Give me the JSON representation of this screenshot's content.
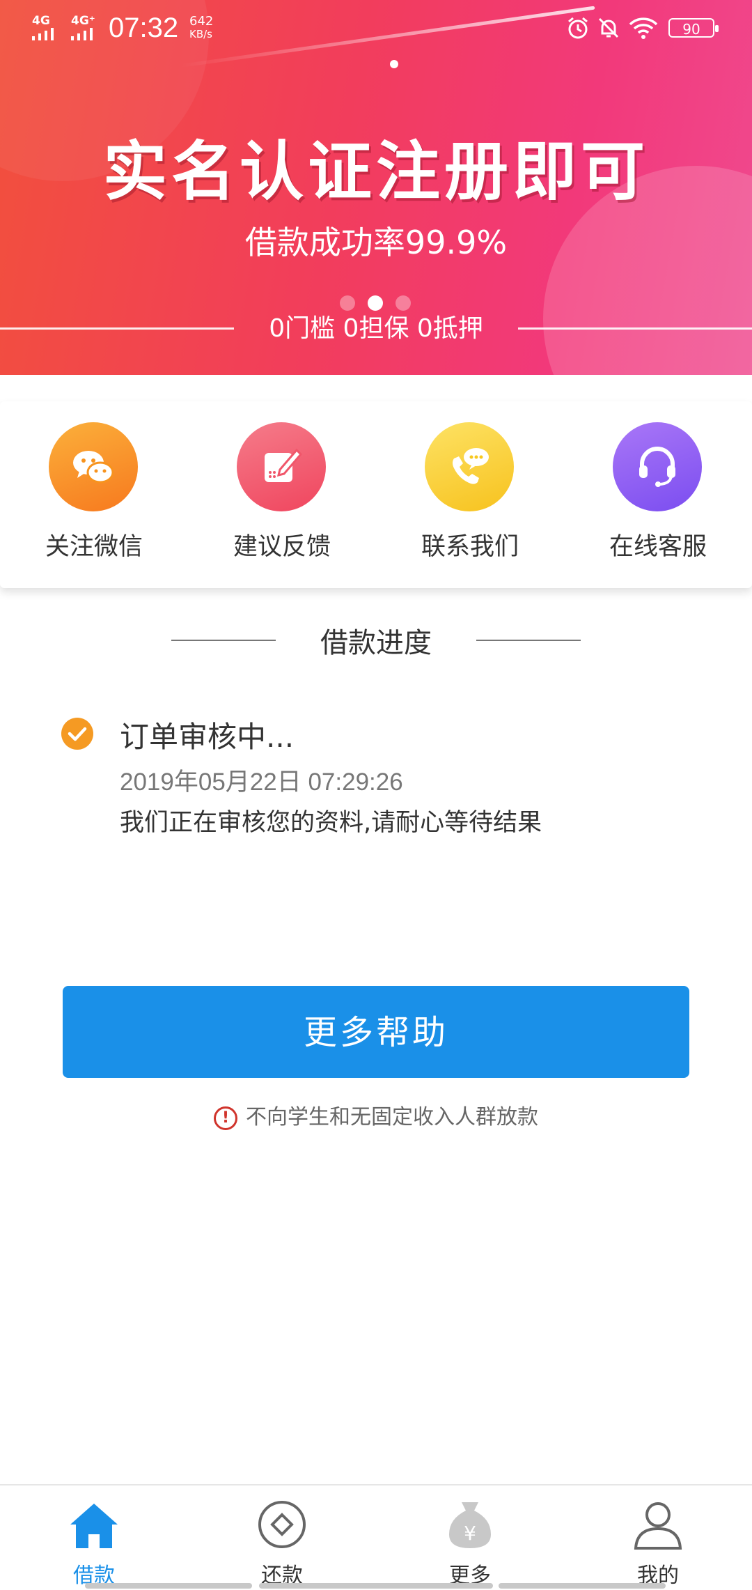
{
  "status_bar": {
    "network1": "4G",
    "network2": "4G⁺",
    "time": "07:32",
    "speed_value": "642",
    "speed_unit": "KB/s",
    "battery": "90",
    "icons": [
      "alarm-icon",
      "bell-muted-icon",
      "wifi-icon",
      "battery-icon"
    ]
  },
  "banner": {
    "headline": "实名认证注册即可",
    "subheadline": "借款成功率99.9%",
    "tags": "0门槛  0担保  0抵押",
    "active_slide": 2,
    "slide_count": 3,
    "colors": {
      "start": "#f2503c",
      "end": "#f04a8f"
    }
  },
  "quick_actions": [
    {
      "label": "关注微信",
      "icon": "wechat-icon",
      "color": "#f7931e"
    },
    {
      "label": "建议反馈",
      "icon": "feedback-edit-icon",
      "color": "#f0566a"
    },
    {
      "label": "联系我们",
      "icon": "phone-chat-icon",
      "color": "#f7c81e"
    },
    {
      "label": "在线客服",
      "icon": "headset-icon",
      "color": "#8f5cf0"
    }
  ],
  "progress": {
    "section_title": "借款进度",
    "status_title": "订单审核中...",
    "timestamp": "2019年05月22日 07:29:26",
    "description": "我们正在审核您的资料,请耐心等待结果"
  },
  "help_button": {
    "label": "更多帮助",
    "color": "#1a90e8"
  },
  "notice": {
    "text": "不向学生和无固定收入人群放款",
    "icon": "alert-circle-icon"
  },
  "tabbar": {
    "active": 0,
    "tabs": [
      {
        "label": "借款",
        "icon": "home-icon"
      },
      {
        "label": "还款",
        "icon": "repay-circle-icon"
      },
      {
        "label": "更多",
        "icon": "money-bag-icon"
      },
      {
        "label": "我的",
        "icon": "user-icon"
      }
    ]
  }
}
